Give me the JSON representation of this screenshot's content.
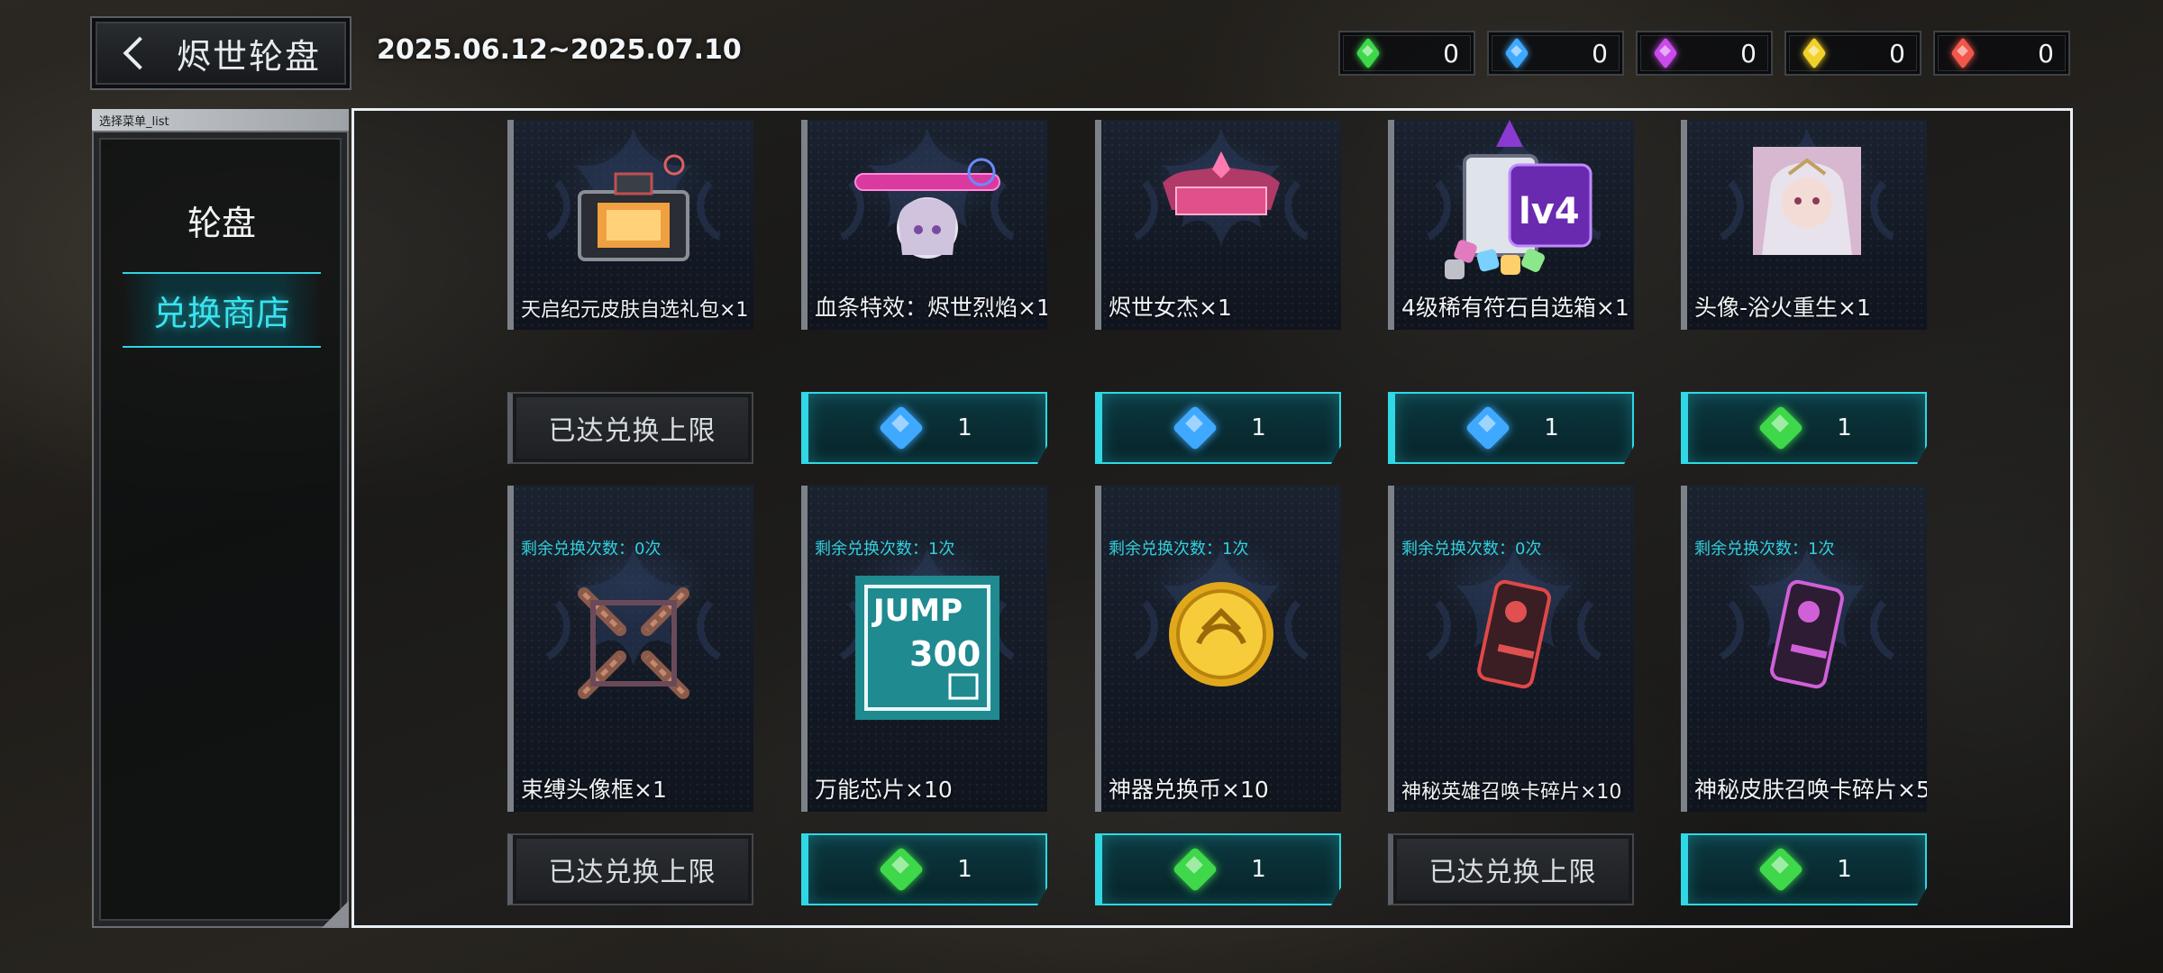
{
  "header": {
    "title": "烬世轮盘",
    "date_range": "2025.06.12~2025.07.10"
  },
  "currencies": [
    {
      "icon": "green-gem-icon",
      "color": "#3ed84a",
      "value": "0"
    },
    {
      "icon": "blue-gem-icon",
      "color": "#3fa9ff",
      "value": "0"
    },
    {
      "icon": "purple-gem-icon",
      "color": "#c84bea",
      "value": "0"
    },
    {
      "icon": "yellow-gem-icon",
      "color": "#f2d12a",
      "value": "0"
    },
    {
      "icon": "red-gem-icon",
      "color": "#f2574a",
      "value": "0"
    }
  ],
  "sidebar": {
    "caption": "选择菜单_list",
    "items": [
      {
        "label": "轮盘",
        "active": false
      },
      {
        "label": "兑换商店",
        "active": true
      }
    ]
  },
  "shop": {
    "maxed_label": "已达兑换上限",
    "items": [
      {
        "name": "天启纪元皮肤自选礼包×1",
        "remaining": "",
        "state": "maxed",
        "cost_gem": "",
        "cost": ""
      },
      {
        "name": "血条特效：烬世烈焰×1",
        "remaining": "",
        "state": "buy",
        "cost_gem": "blue",
        "cost": "1"
      },
      {
        "name": "烬世女杰×1",
        "remaining": "",
        "state": "buy",
        "cost_gem": "blue",
        "cost": "1"
      },
      {
        "name": "4级稀有符石自选箱×1",
        "remaining": "",
        "state": "buy",
        "cost_gem": "blue",
        "cost": "1"
      },
      {
        "name": "头像-浴火重生×1",
        "remaining": "",
        "state": "buy",
        "cost_gem": "green",
        "cost": "1"
      },
      {
        "name": "束缚头像框×1",
        "remaining": "剩余兑换次数：0次",
        "state": "maxed",
        "cost_gem": "",
        "cost": ""
      },
      {
        "name": "万能芯片×10",
        "remaining": "剩余兑换次数：1次",
        "state": "buy",
        "cost_gem": "green",
        "cost": "1"
      },
      {
        "name": "神器兑换币×10",
        "remaining": "剩余兑换次数：1次",
        "state": "buy",
        "cost_gem": "green",
        "cost": "1"
      },
      {
        "name": "神秘英雄召唤卡碎片×10",
        "remaining": "剩余兑换次数：0次",
        "state": "maxed",
        "cost_gem": "",
        "cost": ""
      },
      {
        "name": "神秘皮肤召唤卡碎片×5",
        "remaining": "剩余兑换次数：1次",
        "state": "buy",
        "cost_gem": "green",
        "cost": "1"
      }
    ],
    "art_text": {
      "lv4": "lv4",
      "jump": "JUMP",
      "jump_num": "300"
    }
  }
}
